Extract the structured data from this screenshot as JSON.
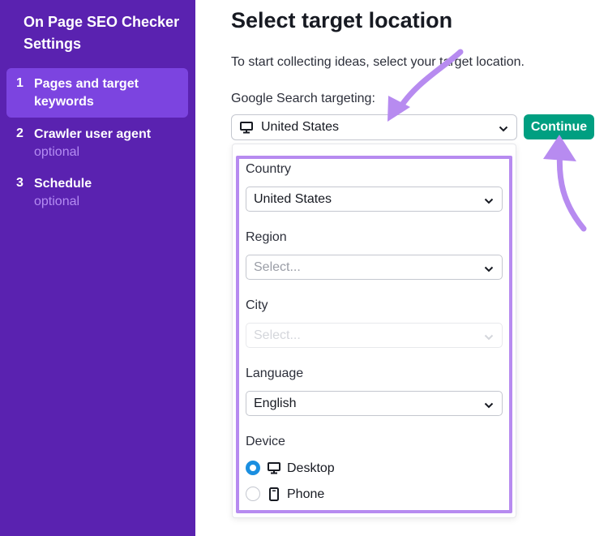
{
  "sidebar": {
    "title": "On Page SEO Checker Settings",
    "steps": [
      {
        "num": "1",
        "label": "Pages and target keywords",
        "sub": ""
      },
      {
        "num": "2",
        "label": "Crawler user agent",
        "sub": "optional"
      },
      {
        "num": "3",
        "label": "Schedule",
        "sub": "optional"
      }
    ]
  },
  "main": {
    "title": "Select target location",
    "subtitle": "To start collecting ideas, select your target location.",
    "targeting_label": "Google Search targeting:",
    "targeting_value": "United States",
    "continue_label": "Continue"
  },
  "panel": {
    "country_label": "Country",
    "country_value": "United States",
    "region_label": "Region",
    "region_placeholder": "Select...",
    "city_label": "City",
    "city_placeholder": "Select...",
    "language_label": "Language",
    "language_value": "English",
    "device_label": "Device",
    "device_options": [
      {
        "label": "Desktop",
        "selected": true
      },
      {
        "label": "Phone",
        "selected": false
      }
    ]
  },
  "colors": {
    "sidebar_bg": "#5a22b0",
    "sidebar_active": "#7c44e0",
    "continue_bg": "#009f81",
    "highlight": "#b78bf0",
    "radio_selected": "#1b8fe0"
  },
  "icons": {
    "targeting": "monitor-icon",
    "desktop": "monitor-icon",
    "phone": "phone-icon",
    "select": "chevron-down-icon"
  }
}
